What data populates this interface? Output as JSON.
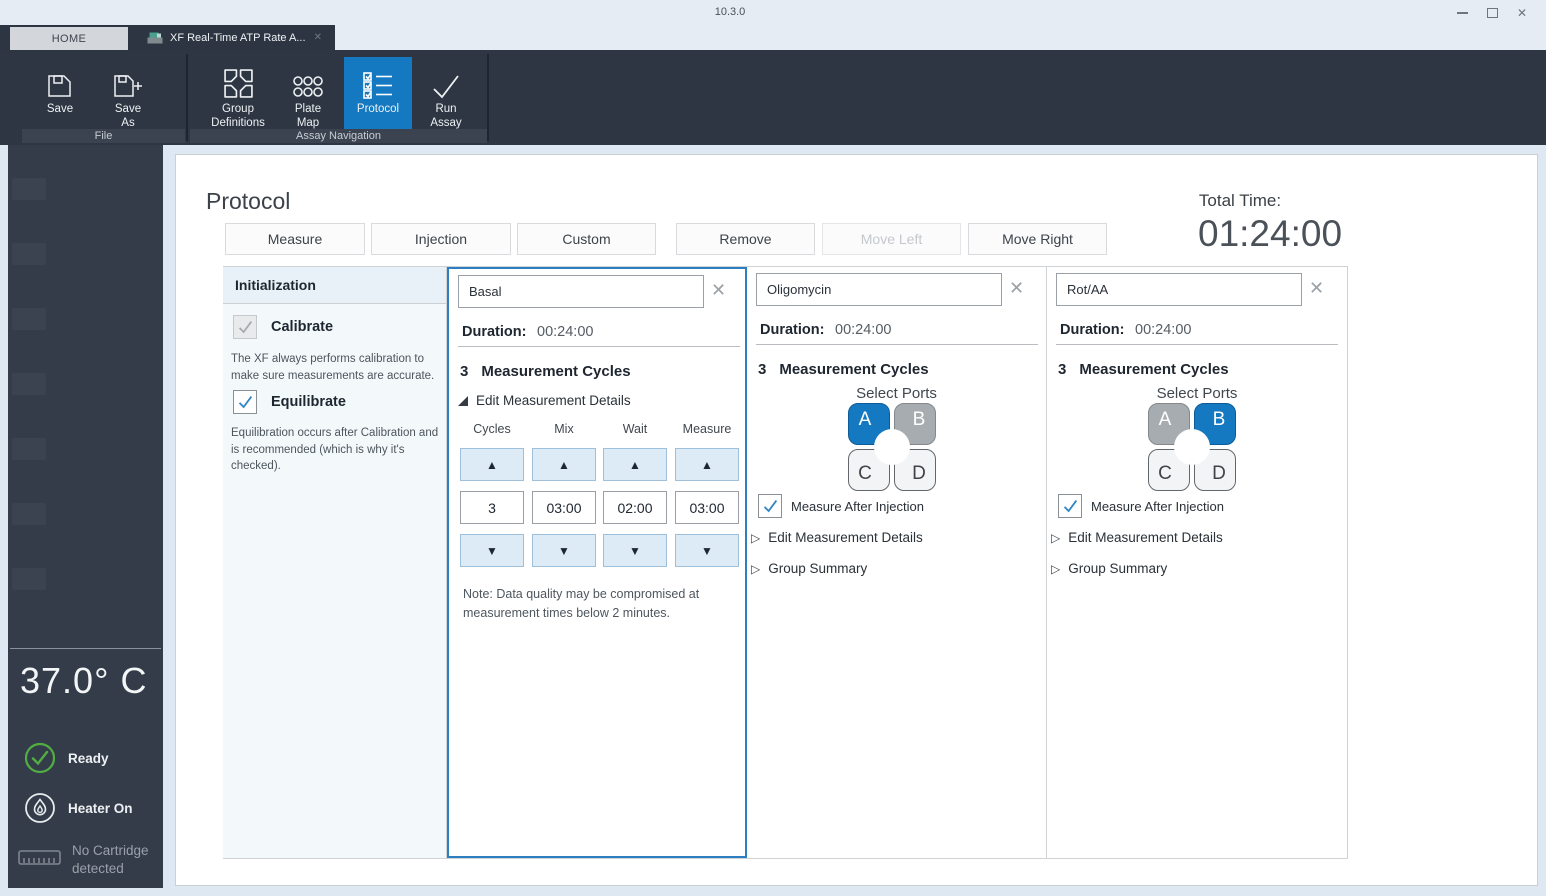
{
  "titlebar": {
    "version": "10.3.0"
  },
  "tabs": {
    "home": "HOME",
    "assay": "XF Real-Time ATP Rate A..."
  },
  "ribbon": {
    "save": "Save",
    "save_as_line1": "Save",
    "save_as_line2": "As",
    "group_definitions_line1": "Group",
    "group_definitions_line2": "Definitions",
    "plate_map_line1": "Plate",
    "plate_map_line2": "Map",
    "protocol": "Protocol",
    "run_assay_line1": "Run",
    "run_assay_line2": "Assay",
    "groups": {
      "file": "File",
      "assay_navigation": "Assay Navigation"
    }
  },
  "page": {
    "title": "Protocol"
  },
  "actions": {
    "measure": "Measure",
    "injection": "Injection",
    "custom": "Custom",
    "remove": "Remove",
    "move_left": "Move Left",
    "move_right": "Move Right"
  },
  "summary": {
    "total_time_label": "Total Time:",
    "total_time": "01:24:00"
  },
  "initialization": {
    "title": "Initialization",
    "calibrate_label": "Calibrate",
    "calibrate_desc": "The XF always performs calibration to make sure measurements are accurate.",
    "equilibrate_label": "Equilibrate",
    "equilibrate_desc": "Equilibration occurs after Calibration and is recommended (which is why it's checked)."
  },
  "basal": {
    "name": "Basal",
    "duration_label": "Duration:",
    "duration": "00:24:00",
    "cycles_count": "3",
    "cycles_label": "Measurement Cycles",
    "edit_details": "Edit Measurement Details",
    "spinners": [
      {
        "header": "Cycles",
        "value": "3"
      },
      {
        "header": "Mix",
        "value": "03:00"
      },
      {
        "header": "Wait",
        "value": "02:00"
      },
      {
        "header": "Measure",
        "value": "03:00"
      }
    ],
    "note": "Note: Data quality may be compromised at measurement times below 2 minutes."
  },
  "oligomycin": {
    "name": "Oligomycin",
    "duration_label": "Duration:",
    "duration": "00:24:00",
    "cycles_count": "3",
    "cycles_label": "Measurement Cycles",
    "select_ports": "Select Ports",
    "ports": {
      "a": {
        "label": "A",
        "state": "selected"
      },
      "b": {
        "label": "B",
        "state": "occupied"
      },
      "c": {
        "label": "C",
        "state": "empty"
      },
      "d": {
        "label": "D",
        "state": "empty"
      }
    },
    "measure_after_injection": "Measure After Injection",
    "edit_details": "Edit Measurement Details",
    "group_summary": "Group Summary"
  },
  "rot_aa": {
    "name": "Rot/AA",
    "duration_label": "Duration:",
    "duration": "00:24:00",
    "cycles_count": "3",
    "cycles_label": "Measurement Cycles",
    "select_ports": "Select Ports",
    "ports": {
      "a": {
        "label": "A",
        "state": "occupied"
      },
      "b": {
        "label": "B",
        "state": "selected"
      },
      "c": {
        "label": "C",
        "state": "empty"
      },
      "d": {
        "label": "D",
        "state": "empty"
      }
    },
    "measure_after_injection": "Measure After Injection",
    "edit_details": "Edit Measurement Details",
    "group_summary": "Group Summary"
  },
  "sidebar": {
    "temperature": "37.0° C",
    "ready": "Ready",
    "heater": "Heater On",
    "cartridge": "No Cartridge detected"
  },
  "colors": {
    "accent_blue": "#1479c1",
    "selected_border": "#2d7fc2",
    "ready_green": "#52ae43",
    "dark_chrome": "#2d3642"
  }
}
